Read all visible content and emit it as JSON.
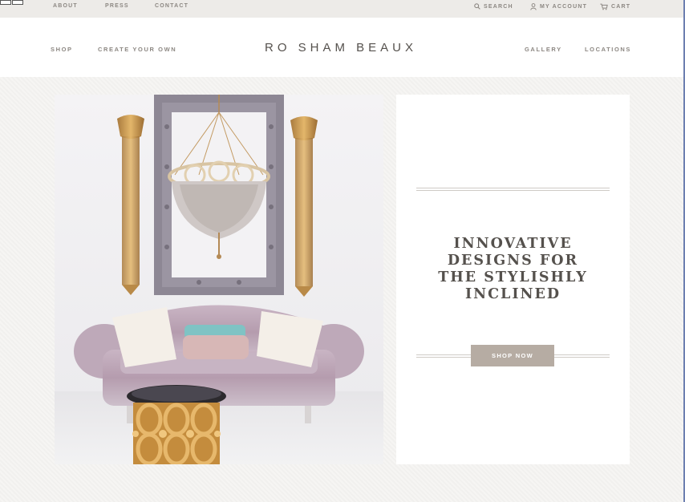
{
  "topbar": {
    "links": [
      "ABOUT",
      "PRESS",
      "CONTACT"
    ],
    "search_label": "SEARCH",
    "account_label": "MY ACCOUNT",
    "cart_label": "CART"
  },
  "header": {
    "logo": "RO SHAM BEAUX",
    "nav_left": [
      "SHOP",
      "CREATE YOUR OWN"
    ],
    "nav_right": [
      "GALLERY",
      "LOCATIONS"
    ]
  },
  "hero": {
    "image_icon": "interior-photo-sofa-chandelier",
    "headline_lines": [
      "INNOVATIVE",
      "DESIGNS FOR",
      "THE STYLISHLY",
      "INCLINED"
    ],
    "cta_label": "SHOP NOW"
  },
  "colors": {
    "button": "#b6aca3",
    "text": "#55514d",
    "topbar": "#edebe8"
  }
}
